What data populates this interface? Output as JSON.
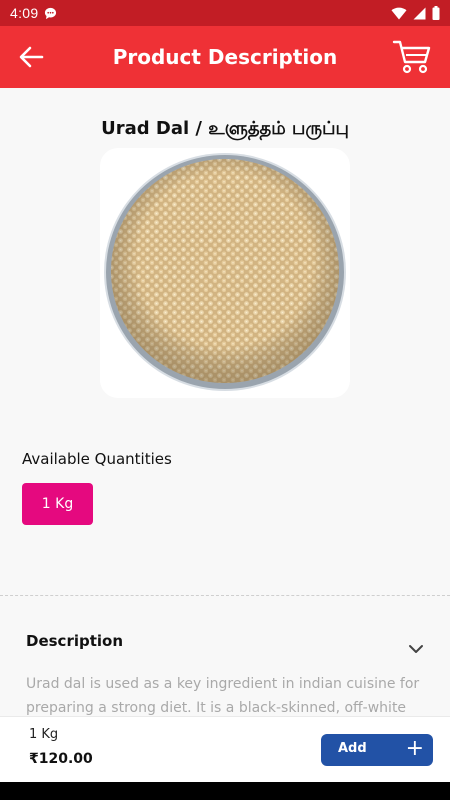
{
  "status_bar": {
    "time": "4:09"
  },
  "app_bar": {
    "title": "Product Description"
  },
  "product": {
    "title": "Urad Dal / உளுத்தம் பருப்பு"
  },
  "quantities": {
    "heading": "Available Quantities",
    "options": [
      "1 Kg"
    ],
    "selected": "1 Kg"
  },
  "description": {
    "heading": "Description",
    "text": "Urad dal is used as a key ingredient in indian cuisine for preparing a strong diet. It is a black-skinned, off-white"
  },
  "bottom_bar": {
    "selected_qty": "1 Kg",
    "price": "₹120.00",
    "add_label": "Add",
    "add_symbol": "+"
  },
  "colors": {
    "status_bar": "#c21d25",
    "app_bar": "#ef3136",
    "chip": "#e5097f",
    "add_button": "#2252a6"
  }
}
